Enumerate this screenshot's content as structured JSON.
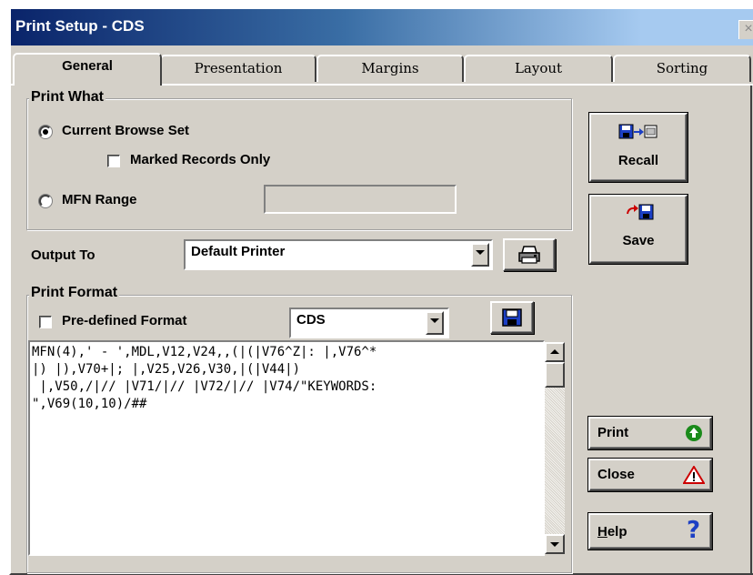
{
  "window": {
    "title": "Print Setup - CDS",
    "close_glyph": "×"
  },
  "tabs": [
    {
      "label": "General",
      "active": true
    },
    {
      "label": "Presentation",
      "active": false
    },
    {
      "label": "Margins",
      "active": false
    },
    {
      "label": "Layout",
      "active": false
    },
    {
      "label": "Sorting",
      "active": false
    }
  ],
  "print_what": {
    "legend": "Print What",
    "current_browse_set": "Current Browse Set",
    "current_browse_set_selected": true,
    "marked_records_only": "Marked Records Only",
    "marked_records_only_checked": false,
    "mfn_range": "MFN Range",
    "mfn_range_selected": false,
    "mfn_range_value": ""
  },
  "output": {
    "label": "Output To",
    "selected": "Default Printer"
  },
  "print_format": {
    "legend": "Print Format",
    "predefined_label": "Pre-defined Format",
    "predefined_checked": false,
    "format_selected": "CDS",
    "format_text": "MFN(4),' - ',MDL,V12,V24,,(|(|V76^Z|: |,V76^*\n|) |),V70+|; |,V25,V26,V30,|(|V44|)\n |,V50,/|// |V71/|// |V72/|// |V74/\"KEYWORDS:\n\",V69(10,10)/##"
  },
  "buttons": {
    "recall": "Recall",
    "save": "Save",
    "print": "Print",
    "close": "Close",
    "help": "Help",
    "help_mnemonic": "H",
    "help_rest": "elp"
  },
  "icons": {
    "recall": "floppy-to-screen-icon",
    "save": "arrow-into-floppy-icon",
    "printer": "printer-icon",
    "save_format": "floppy-disk-icon",
    "print": "green-up-arrow-icon",
    "close": "warning-triangle-icon",
    "help": "question-mark-icon"
  },
  "colors": {
    "title_start": "#0a246a",
    "title_end": "#a6caf0",
    "face": "#d4d0c8",
    "floppy_blue": "#1c3fc4",
    "print_green": "#1a8a1a",
    "warning_red": "#cc0000"
  }
}
